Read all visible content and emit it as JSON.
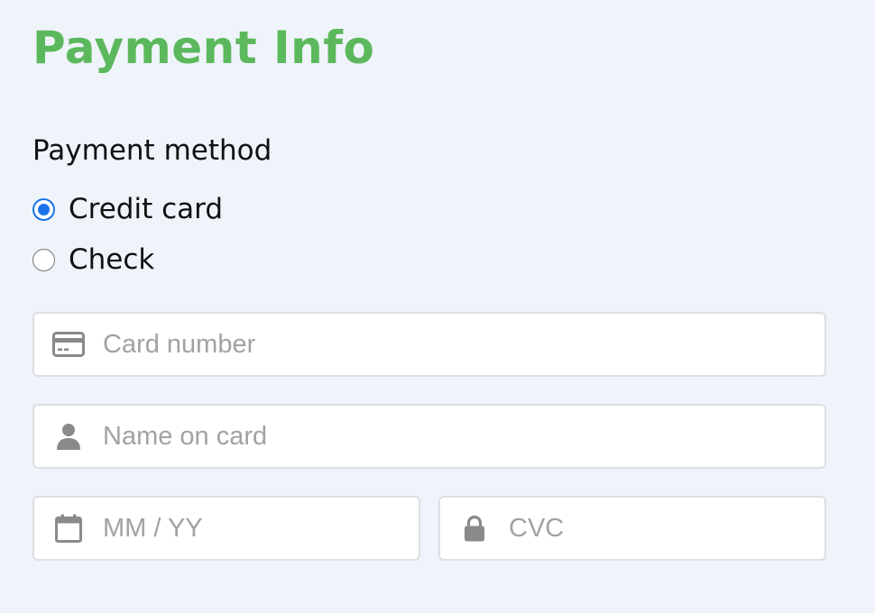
{
  "page": {
    "title": "Payment Info"
  },
  "payment_method": {
    "label": "Payment method",
    "options": [
      {
        "label": "Credit card",
        "selected": true
      },
      {
        "label": "Check",
        "selected": false
      }
    ]
  },
  "fields": {
    "card_number": {
      "placeholder": "Card number",
      "value": "",
      "icon": "credit-card-icon"
    },
    "name_on_card": {
      "placeholder": "Name on card",
      "value": "",
      "icon": "user-icon"
    },
    "expiry": {
      "placeholder": "MM / YY",
      "value": "",
      "icon": "calendar-icon"
    },
    "cvc": {
      "placeholder": "CVC",
      "value": "",
      "icon": "lock-icon"
    }
  },
  "colors": {
    "title": "#5cb85c",
    "background": "#eff4fb",
    "radio_selected": "#1a73e8",
    "field_border": "#dcdfe3",
    "icon": "#8a8a8a",
    "placeholder": "#a2a2a2"
  }
}
